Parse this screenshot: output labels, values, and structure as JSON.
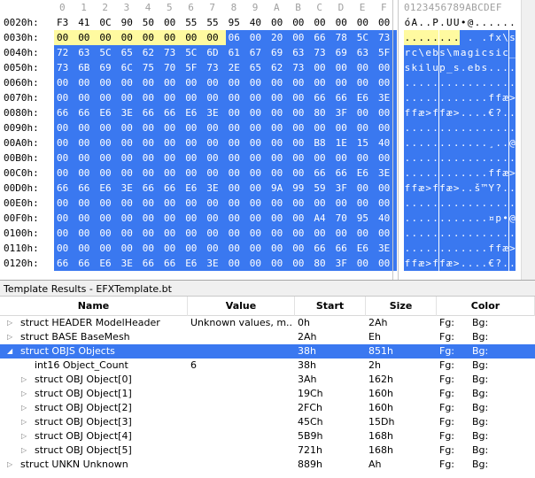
{
  "hex_header": {
    "columns": [
      "0",
      "1",
      "2",
      "3",
      "4",
      "5",
      "6",
      "7",
      "8",
      "9",
      "A",
      "B",
      "C",
      "D",
      "E",
      "F"
    ],
    "ascii_header": "0123456789ABCDEF"
  },
  "hex_rows": [
    {
      "offset": "0020h:",
      "bytes": [
        "F3",
        "41",
        "0C",
        "90",
        "50",
        "00",
        "55",
        "55",
        "95",
        "40",
        "00",
        "00",
        "00",
        "00",
        "00",
        "00"
      ],
      "ascii": "óA..P.UU•@......",
      "hl": "pppppppppppppppp"
    },
    {
      "offset": "0030h:",
      "bytes": [
        "00",
        "00",
        "00",
        "00",
        "00",
        "00",
        "00",
        "00",
        "06",
        "00",
        "20",
        "00",
        "66",
        "78",
        "5C",
        "73"
      ],
      "ascii": "........ . .fx\\s",
      "hl": "yyyyyyyybbbbbbbb"
    },
    {
      "offset": "0040h:",
      "bytes": [
        "72",
        "63",
        "5C",
        "65",
        "62",
        "73",
        "5C",
        "6D",
        "61",
        "67",
        "69",
        "63",
        "73",
        "69",
        "63",
        "5F"
      ],
      "ascii": "rc\\ebs\\magicsic_",
      "hl": "bbbbbbbbbbbbbbbb"
    },
    {
      "offset": "0050h:",
      "bytes": [
        "73",
        "6B",
        "69",
        "6C",
        "75",
        "70",
        "5F",
        "73",
        "2E",
        "65",
        "62",
        "73",
        "00",
        "00",
        "00",
        "00"
      ],
      "ascii": "skilup_s.ebs....",
      "hl": "bbbbbbbbbbbbbbbb"
    },
    {
      "offset": "0060h:",
      "bytes": [
        "00",
        "00",
        "00",
        "00",
        "00",
        "00",
        "00",
        "00",
        "00",
        "00",
        "00",
        "00",
        "00",
        "00",
        "00",
        "00"
      ],
      "ascii": "................",
      "hl": "bbbbbbbbbbbbbbbb"
    },
    {
      "offset": "0070h:",
      "bytes": [
        "00",
        "00",
        "00",
        "00",
        "00",
        "00",
        "00",
        "00",
        "00",
        "00",
        "00",
        "00",
        "66",
        "66",
        "E6",
        "3E"
      ],
      "ascii": "............ffæ>",
      "hl": "bbbbbbbbbbbbbbbb"
    },
    {
      "offset": "0080h:",
      "bytes": [
        "66",
        "66",
        "E6",
        "3E",
        "66",
        "66",
        "E6",
        "3E",
        "00",
        "00",
        "00",
        "00",
        "80",
        "3F",
        "00",
        "00"
      ],
      "ascii": "ffæ>ffæ>....€?..",
      "hl": "bbbbbbbbbbbbbbbb"
    },
    {
      "offset": "0090h:",
      "bytes": [
        "00",
        "00",
        "00",
        "00",
        "00",
        "00",
        "00",
        "00",
        "00",
        "00",
        "00",
        "00",
        "00",
        "00",
        "00",
        "00"
      ],
      "ascii": "................",
      "hl": "bbbbbbbbbbbbbbbb"
    },
    {
      "offset": "00A0h:",
      "bytes": [
        "00",
        "00",
        "00",
        "00",
        "00",
        "00",
        "00",
        "00",
        "00",
        "00",
        "00",
        "00",
        "B8",
        "1E",
        "15",
        "40"
      ],
      "ascii": "............¸..@",
      "hl": "bbbbbbbbbbbbbbbb"
    },
    {
      "offset": "00B0h:",
      "bytes": [
        "00",
        "00",
        "00",
        "00",
        "00",
        "00",
        "00",
        "00",
        "00",
        "00",
        "00",
        "00",
        "00",
        "00",
        "00",
        "00"
      ],
      "ascii": "................",
      "hl": "bbbbbbbbbbbbbbbb"
    },
    {
      "offset": "00C0h:",
      "bytes": [
        "00",
        "00",
        "00",
        "00",
        "00",
        "00",
        "00",
        "00",
        "00",
        "00",
        "00",
        "00",
        "66",
        "66",
        "E6",
        "3E"
      ],
      "ascii": "............ffæ>",
      "hl": "bbbbbbbbbbbbbbbb"
    },
    {
      "offset": "00D0h:",
      "bytes": [
        "66",
        "66",
        "E6",
        "3E",
        "66",
        "66",
        "E6",
        "3E",
        "00",
        "00",
        "9A",
        "99",
        "59",
        "3F",
        "00",
        "00"
      ],
      "ascii": "ffæ>ffæ>..š™Y?..",
      "hl": "bbbbbbbbbbbbbbbb"
    },
    {
      "offset": "00E0h:",
      "bytes": [
        "00",
        "00",
        "00",
        "00",
        "00",
        "00",
        "00",
        "00",
        "00",
        "00",
        "00",
        "00",
        "00",
        "00",
        "00",
        "00"
      ],
      "ascii": "................",
      "hl": "bbbbbbbbbbbbbbbb"
    },
    {
      "offset": "00F0h:",
      "bytes": [
        "00",
        "00",
        "00",
        "00",
        "00",
        "00",
        "00",
        "00",
        "00",
        "00",
        "00",
        "00",
        "A4",
        "70",
        "95",
        "40"
      ],
      "ascii": "............¤p•@",
      "hl": "bbbbbbbbbbbbbbbb"
    },
    {
      "offset": "0100h:",
      "bytes": [
        "00",
        "00",
        "00",
        "00",
        "00",
        "00",
        "00",
        "00",
        "00",
        "00",
        "00",
        "00",
        "00",
        "00",
        "00",
        "00"
      ],
      "ascii": "................",
      "hl": "bbbbbbbbbbbbbbbb"
    },
    {
      "offset": "0110h:",
      "bytes": [
        "00",
        "00",
        "00",
        "00",
        "00",
        "00",
        "00",
        "00",
        "00",
        "00",
        "00",
        "00",
        "66",
        "66",
        "E6",
        "3E"
      ],
      "ascii": "............ffæ>",
      "hl": "bbbbbbbbbbbbbbbb"
    },
    {
      "offset": "0120h:",
      "bytes": [
        "66",
        "66",
        "E6",
        "3E",
        "66",
        "66",
        "E6",
        "3E",
        "00",
        "00",
        "00",
        "00",
        "80",
        "3F",
        "00",
        "00"
      ],
      "ascii": "ffæ>ffæ>....€?..",
      "hl": "bbbbbbbbbbbbbbbb"
    }
  ],
  "template_panel": {
    "title": "Template Results - EFXTemplate.bt",
    "columns": [
      "Name",
      "Value",
      "Start",
      "Size",
      "Color"
    ]
  },
  "template_rows": [
    {
      "name": "struct HEADER ModelHeader",
      "value": "Unknown values, m...",
      "start": "0h",
      "size": "2Ah",
      "fg": "Fg:",
      "bg": "Bg:",
      "indent": 0,
      "expander": "closed",
      "selected": false
    },
    {
      "name": "struct BASE BaseMesh",
      "value": "",
      "start": "2Ah",
      "size": "Eh",
      "fg": "Fg:",
      "bg": "Bg:",
      "indent": 0,
      "expander": "closed",
      "selected": false
    },
    {
      "name": "struct OBJS Objects",
      "value": "",
      "start": "38h",
      "size": "851h",
      "fg": "Fg:",
      "bg": "Bg:",
      "indent": 0,
      "expander": "open",
      "selected": true
    },
    {
      "name": "int16 Object_Count",
      "value": "6",
      "start": "38h",
      "size": "2h",
      "fg": "Fg:",
      "bg": "Bg:",
      "indent": 1,
      "expander": "none",
      "selected": false
    },
    {
      "name": "struct OBJ Object[0]",
      "value": "",
      "start": "3Ah",
      "size": "162h",
      "fg": "Fg:",
      "bg": "Bg:",
      "indent": 1,
      "expander": "closed",
      "selected": false
    },
    {
      "name": "struct OBJ Object[1]",
      "value": "",
      "start": "19Ch",
      "size": "160h",
      "fg": "Fg:",
      "bg": "Bg:",
      "indent": 1,
      "expander": "closed",
      "selected": false
    },
    {
      "name": "struct OBJ Object[2]",
      "value": "",
      "start": "2FCh",
      "size": "160h",
      "fg": "Fg:",
      "bg": "Bg:",
      "indent": 1,
      "expander": "closed",
      "selected": false
    },
    {
      "name": "struct OBJ Object[3]",
      "value": "",
      "start": "45Ch",
      "size": "15Dh",
      "fg": "Fg:",
      "bg": "Bg:",
      "indent": 1,
      "expander": "closed",
      "selected": false
    },
    {
      "name": "struct OBJ Object[4]",
      "value": "",
      "start": "5B9h",
      "size": "168h",
      "fg": "Fg:",
      "bg": "Bg:",
      "indent": 1,
      "expander": "closed",
      "selected": false
    },
    {
      "name": "struct OBJ Object[5]",
      "value": "",
      "start": "721h",
      "size": "168h",
      "fg": "Fg:",
      "bg": "Bg:",
      "indent": 1,
      "expander": "closed",
      "selected": false
    },
    {
      "name": "struct UNKN Unknown",
      "value": "",
      "start": "889h",
      "size": "Ah",
      "fg": "Fg:",
      "bg": "Bg:",
      "indent": 0,
      "expander": "closed",
      "selected": false
    }
  ],
  "colors": {
    "selection_blue": "#3a78f0",
    "highlight_yellow": "#fffaa0"
  }
}
